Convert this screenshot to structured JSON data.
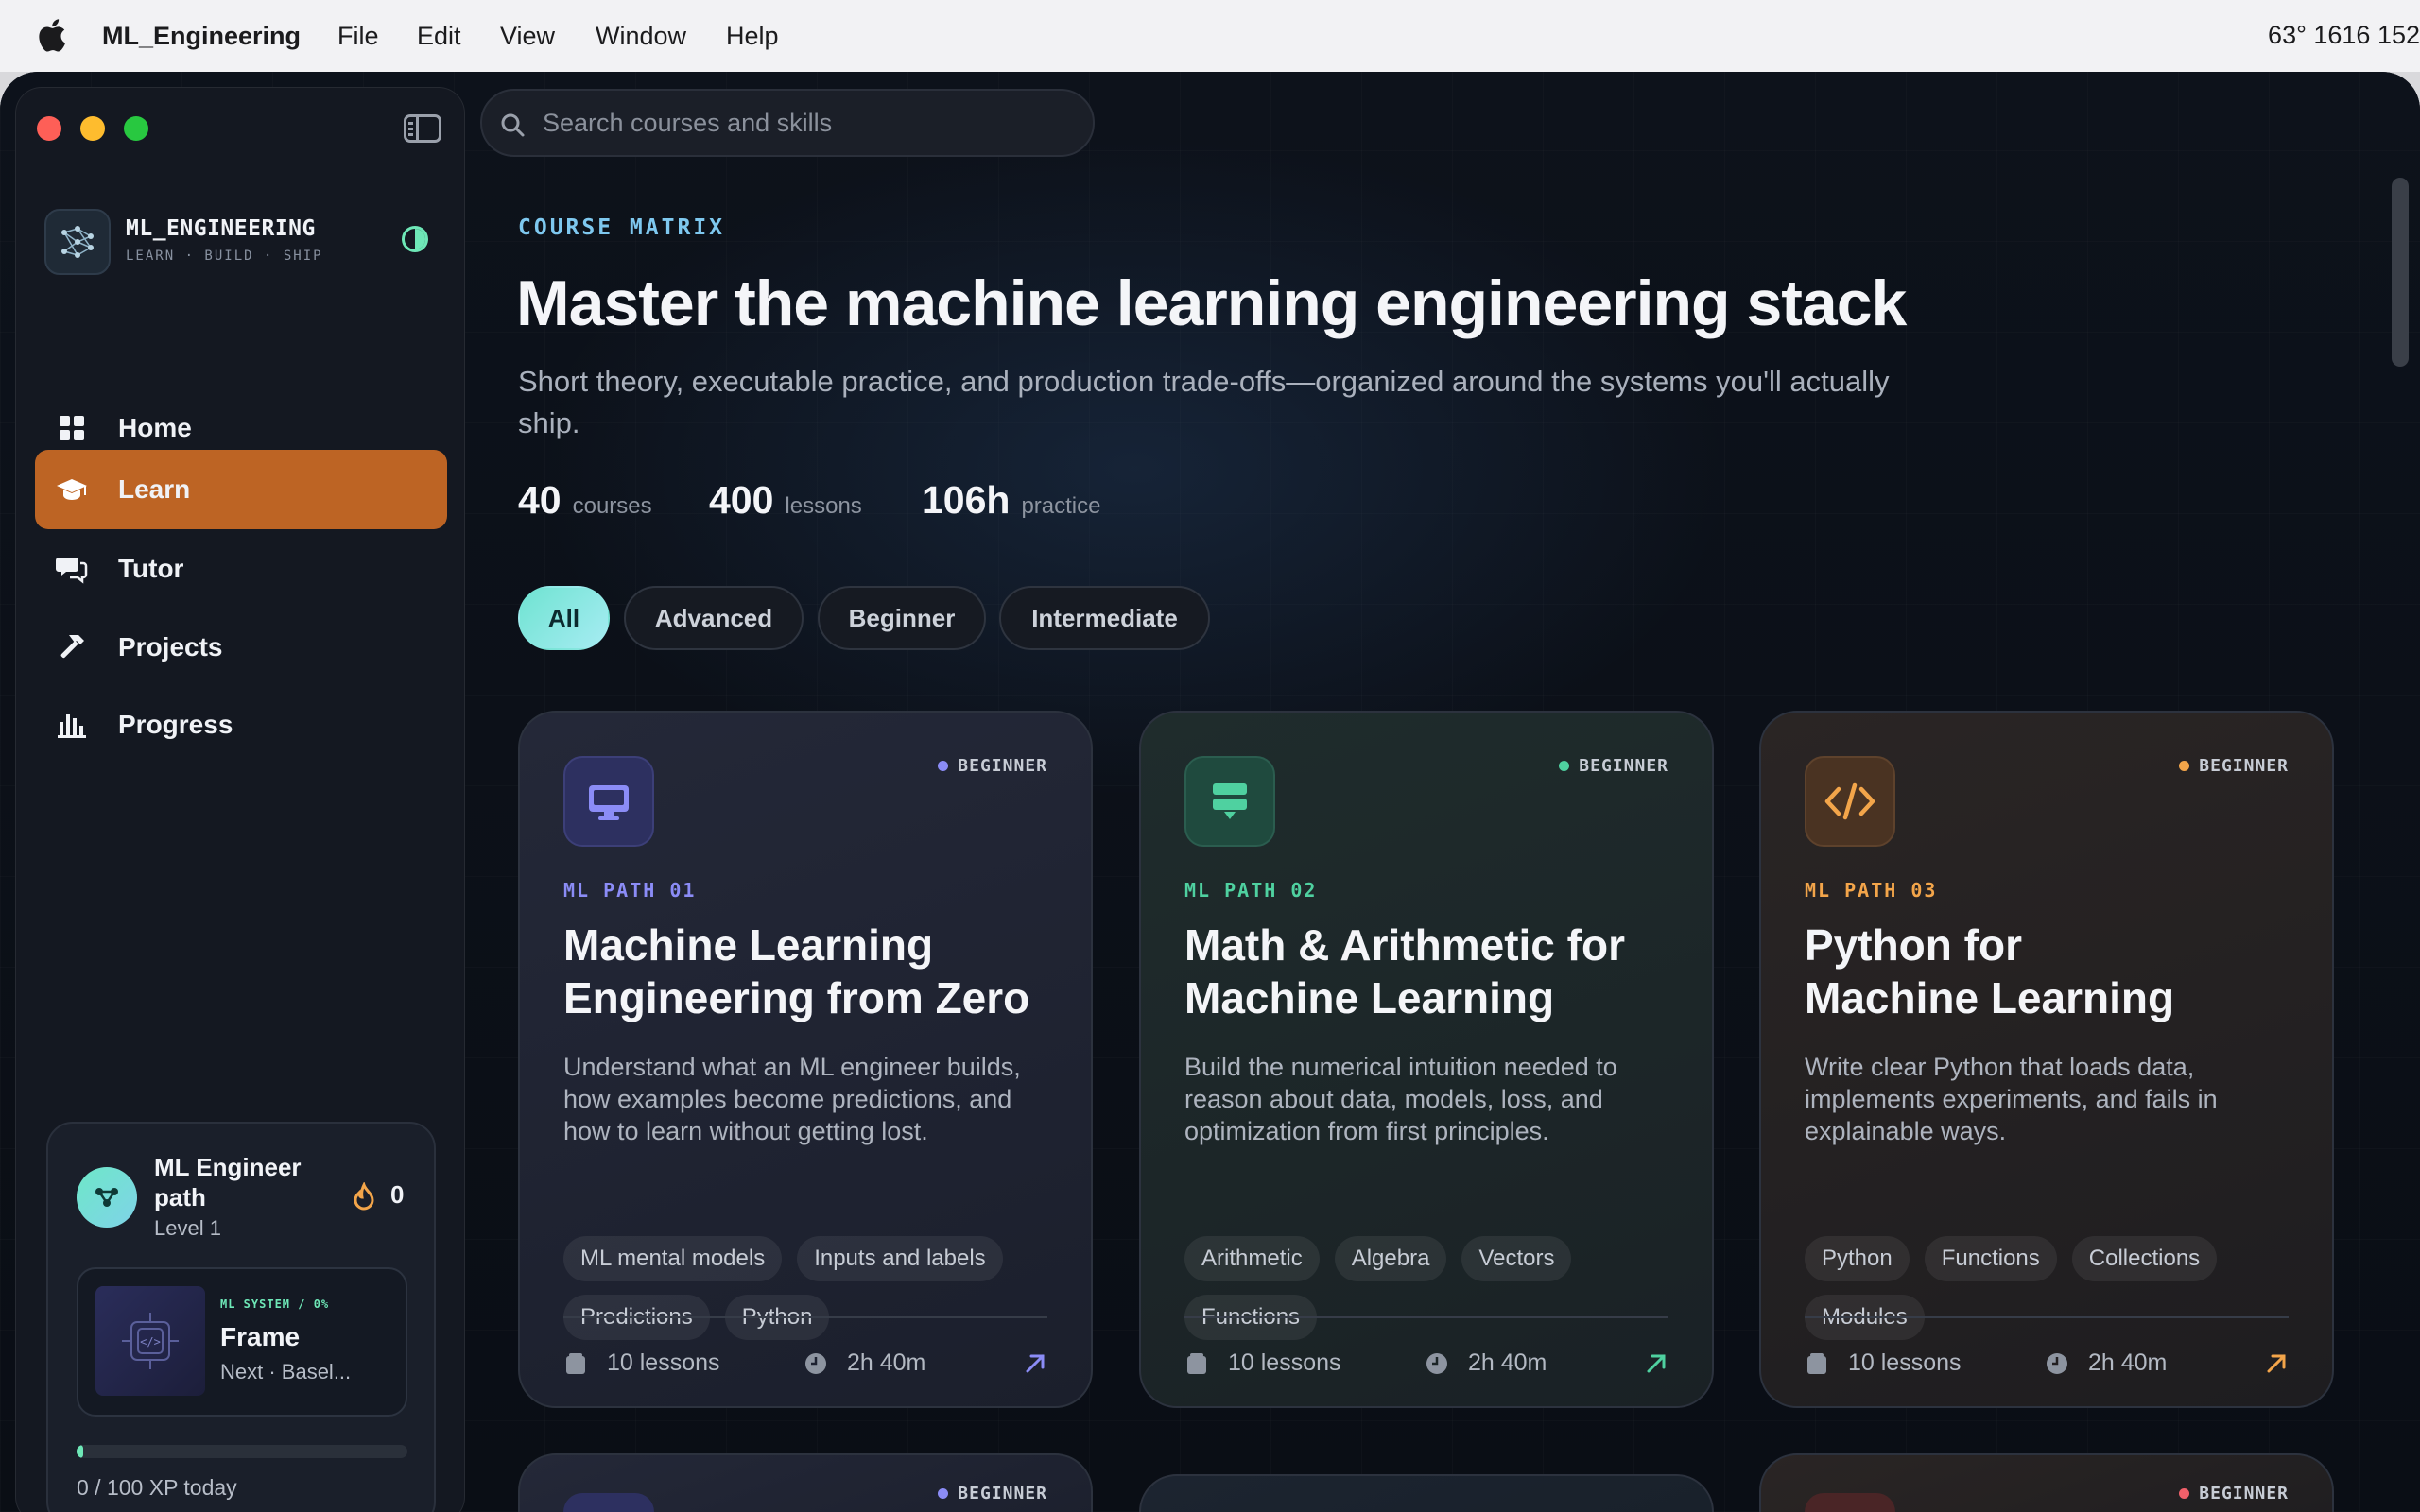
{
  "menubar": {
    "app_name": "ML_Engineering",
    "menus": [
      "File",
      "Edit",
      "View",
      "Window",
      "Help"
    ],
    "status": "63°  1616  152"
  },
  "search": {
    "placeholder": "Search courses and skills"
  },
  "brand": {
    "name": "ML_ENGINEERING",
    "tagline": "LEARN · BUILD · SHIP"
  },
  "nav": [
    {
      "label": "Home",
      "icon": "grid-icon"
    },
    {
      "label": "Learn",
      "icon": "graduation-cap-icon",
      "active": true
    },
    {
      "label": "Tutor",
      "icon": "chat-bubbles-icon"
    },
    {
      "label": "Projects",
      "icon": "hammer-icon"
    },
    {
      "label": "Progress",
      "icon": "bar-chart-icon"
    }
  ],
  "path_card": {
    "title": "ML Engineer path",
    "level": "Level 1",
    "streak": "0",
    "frame_kicker": "ML SYSTEM / 0%",
    "frame_title": "Frame",
    "frame_next": "Next · Basel...",
    "xp_text": "0 / 100 XP today",
    "xp_progress": 0.02
  },
  "hero": {
    "kicker": "COURSE MATRIX",
    "title": "Master the machine learning engineering stack",
    "subtitle": "Short theory, executable practice, and production trade-offs—organized around the systems you'll actually ship.",
    "stats": [
      {
        "value": "40",
        "label": "courses"
      },
      {
        "value": "400",
        "label": "lessons"
      },
      {
        "value": "106h",
        "label": "practice"
      }
    ]
  },
  "filters": [
    "All",
    "Advanced",
    "Beginner",
    "Intermediate"
  ],
  "courses": [
    {
      "level": "BEGINNER",
      "path": "ML PATH 01",
      "title": "Machine Learning Engineering from Zero",
      "description": "Understand what an ML engineer builds, how examples become predictions, and how to learn without getting lost.",
      "tags": [
        "ML mental models",
        "Inputs and labels",
        "Predictions",
        "Python"
      ],
      "lessons": "10 lessons",
      "duration": "2h 40m",
      "accent": "#8b8cf6",
      "icon": "monitor-icon"
    },
    {
      "level": "BEGINNER",
      "path": "ML PATH 02",
      "title": "Math & Arithmetic for Machine Learning",
      "description": "Build the numerical intuition needed to reason about data, models, loss, and optimization from first principles.",
      "tags": [
        "Arithmetic",
        "Algebra",
        "Vectors",
        "Functions"
      ],
      "lessons": "10 lessons",
      "duration": "2h 40m",
      "accent": "#4fd1a0",
      "icon": "signpost-icon"
    },
    {
      "level": "BEGINNER",
      "path": "ML PATH 03",
      "title": "Python for Machine Learning",
      "description": "Write clear Python that loads data, implements experiments, and fails in explainable ways.",
      "tags": [
        "Python",
        "Functions",
        "Collections",
        "Modules"
      ],
      "lessons": "10 lessons",
      "duration": "2h 40m",
      "accent": "#f3a54a",
      "icon": "code-icon"
    }
  ],
  "next_row_levels": [
    "BEGINNER",
    "BEGINNER"
  ]
}
